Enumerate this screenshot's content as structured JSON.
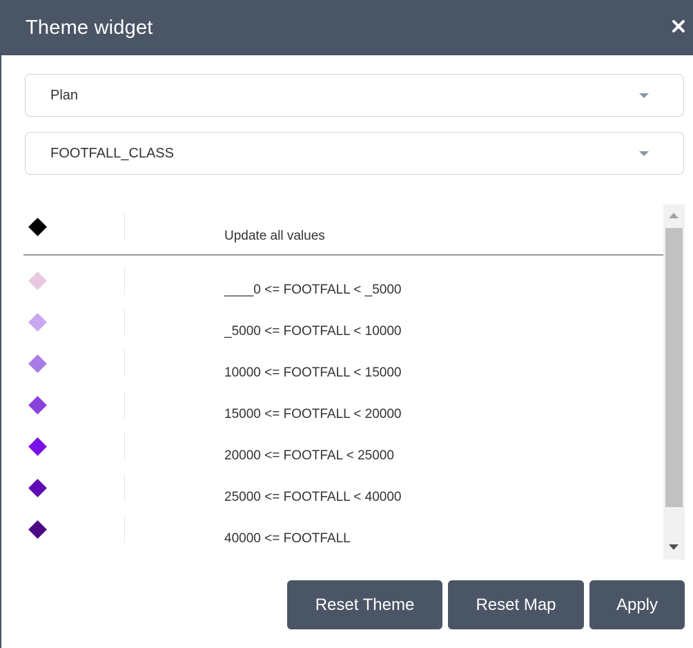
{
  "header": {
    "title": "Theme widget",
    "close_glyph": "×"
  },
  "selects": {
    "layer": {
      "value": "Plan"
    },
    "field": {
      "value": "FOOTFALL_CLASS"
    }
  },
  "legend": {
    "header_row": {
      "label": "Update all values",
      "color": "#000000"
    },
    "items": [
      {
        "label": "____0 <= FOOTFALL < _5000",
        "color": "#e8c9e0"
      },
      {
        "label": "_5000 <= FOOTFALL < 10000",
        "color": "#c8a7ef"
      },
      {
        "label": "10000 <= FOOTFALL < 15000",
        "color": "#a87ce6"
      },
      {
        "label": "15000 <= FOOTFALL < 20000",
        "color": "#8a42dd"
      },
      {
        "label": "20000 <= FOOTFAL < 25000",
        "color": "#7a10e8"
      },
      {
        "label": "25000 <= FOOTFALL < 40000",
        "color": "#5e0bb5"
      },
      {
        "label": "40000 <= FOOTFALL",
        "color": "#4a0884"
      }
    ]
  },
  "buttons": {
    "reset_theme": "Reset Theme",
    "reset_map": "Reset Map",
    "apply": "Apply"
  },
  "colors": {
    "header_bg": "#4a5566",
    "button_bg": "#4a5566"
  },
  "icons": [
    "close-icon",
    "chevron-down-icon",
    "diamond-symbol",
    "scroll-up-arrow",
    "scroll-down-arrow"
  ]
}
